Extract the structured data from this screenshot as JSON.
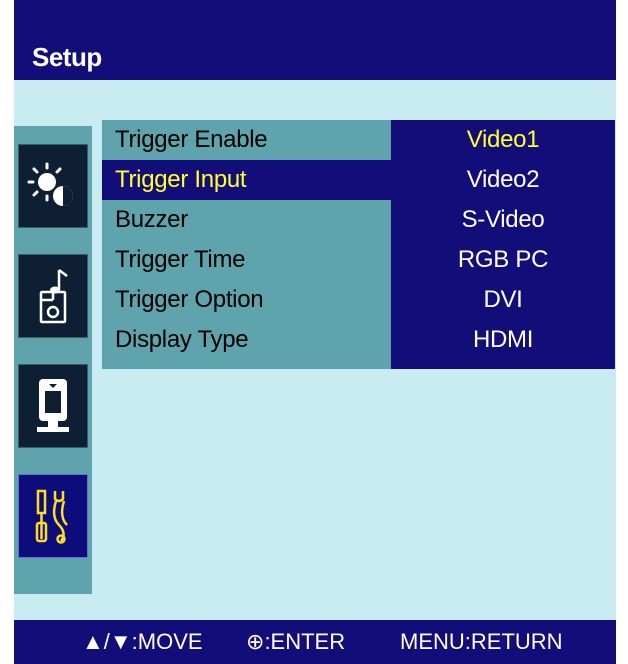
{
  "header": {
    "title": "Setup"
  },
  "sidebar": {
    "icons": [
      {
        "name": "picture-icon",
        "active": false
      },
      {
        "name": "sound-icon",
        "active": false
      },
      {
        "name": "screen-icon",
        "active": false
      },
      {
        "name": "setup-tools-icon",
        "active": true
      }
    ]
  },
  "menu": {
    "items": [
      {
        "label": "Trigger Enable"
      },
      {
        "label": "Trigger Input",
        "selected": true
      },
      {
        "label": "Buzzer"
      },
      {
        "label": "Trigger Time"
      },
      {
        "label": "Trigger Option"
      },
      {
        "label": "Display Type"
      }
    ]
  },
  "options": {
    "items": [
      {
        "label": "Video1",
        "current": true
      },
      {
        "label": "Video2"
      },
      {
        "label": "S-Video"
      },
      {
        "label": "RGB PC"
      },
      {
        "label": "DVI"
      },
      {
        "label": "HDMI"
      }
    ]
  },
  "footer": {
    "move": {
      "keys": "▲/▼",
      "label": ":MOVE"
    },
    "enter": {
      "keys": "⊕",
      "label": ":ENTER"
    },
    "return": {
      "keys": "MENU",
      "label": ":RETURN"
    }
  },
  "colors": {
    "header_bg": "#120d78",
    "body_bg": "#c9ebf2",
    "menu_bg": "#5fa3ad",
    "highlight_text": "#ffff33"
  }
}
